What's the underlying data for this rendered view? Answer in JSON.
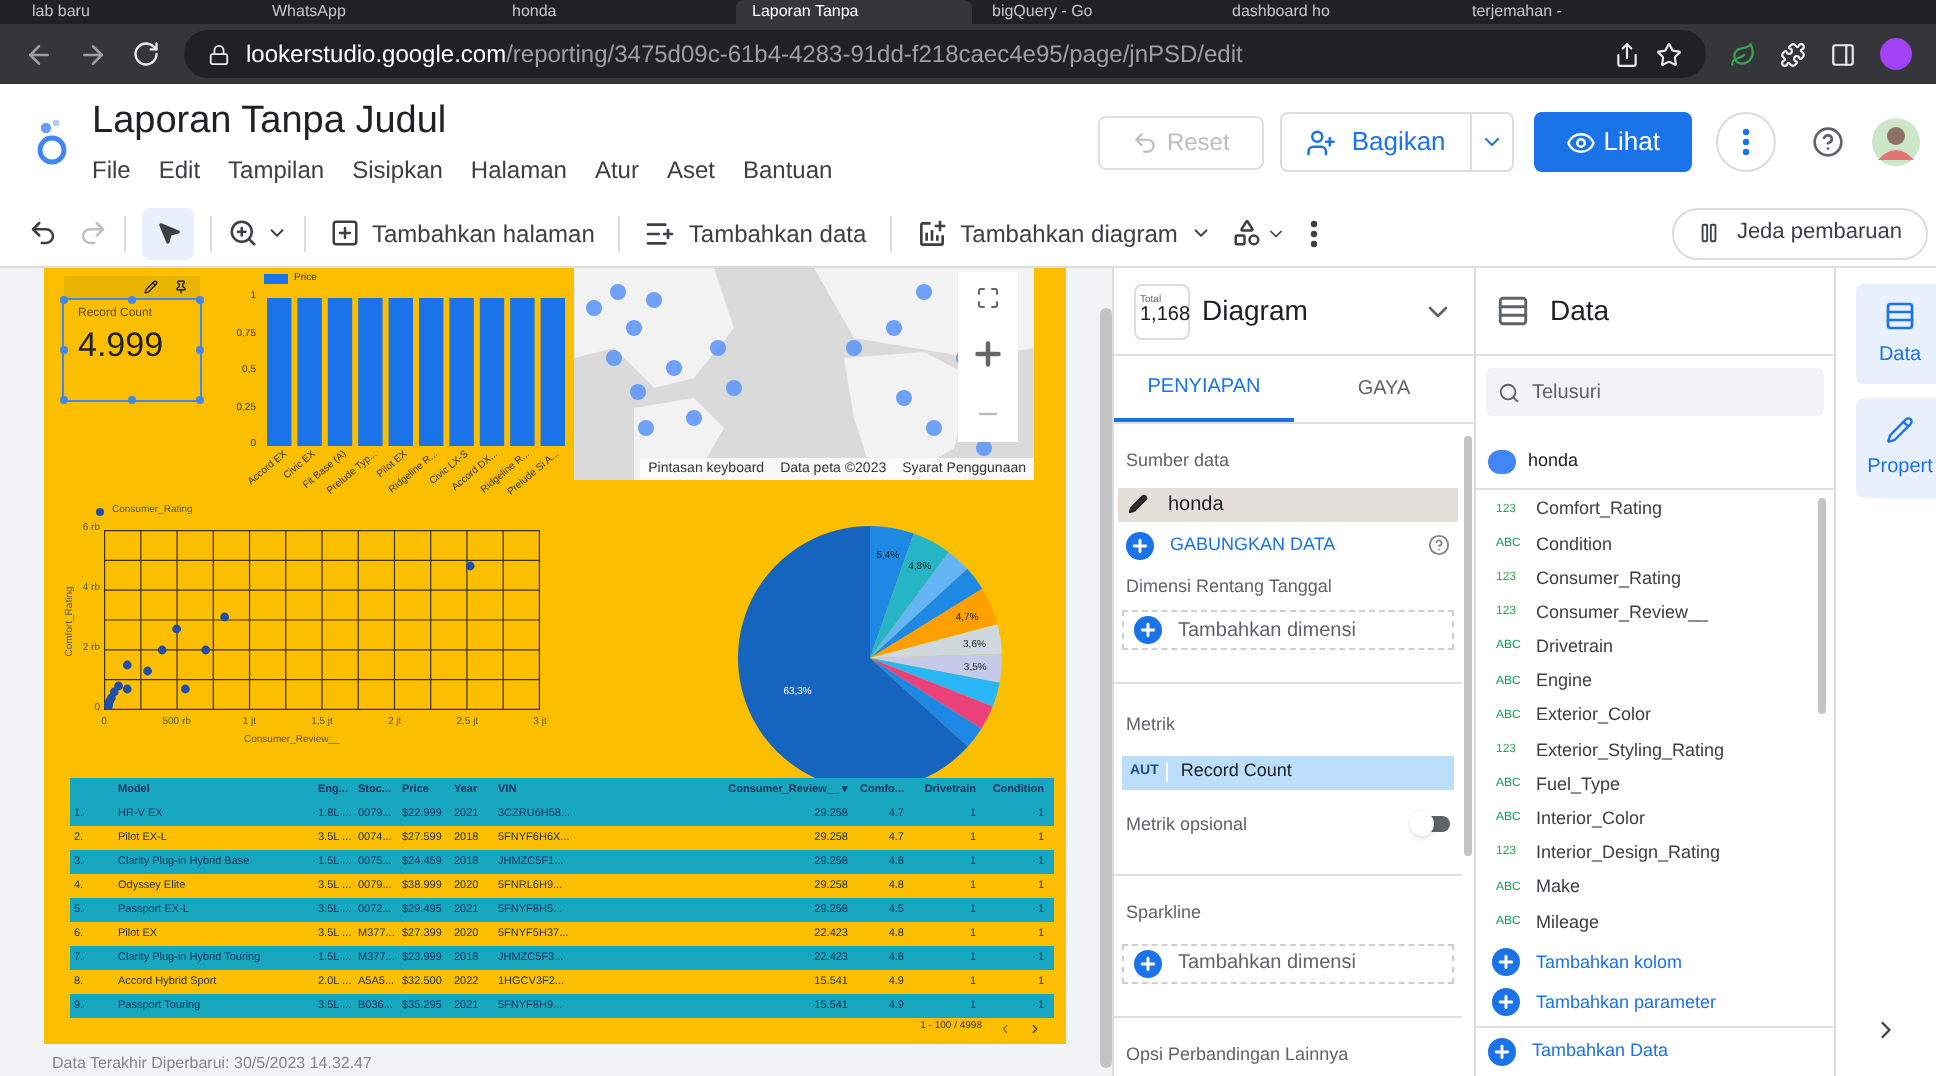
{
  "browser": {
    "tabs": [
      {
        "title": "lab baru",
        "selected": false
      },
      {
        "title": "WhatsApp",
        "selected": false
      },
      {
        "title": "honda",
        "selected": false
      },
      {
        "title": "Laporan Tanpa",
        "selected": true
      },
      {
        "title": "bigQuery - Go",
        "selected": false
      },
      {
        "title": "dashboard ho",
        "selected": false
      },
      {
        "title": "terjemahan -",
        "selected": false
      }
    ],
    "url_host": "lookerstudio.google.com",
    "url_path": "/reporting/3475d09c-61b4-4283-91dd-f218caec4e95/page/jnPSD/edit"
  },
  "app": {
    "title": "Laporan Tanpa Judul",
    "menu": [
      "File",
      "Edit",
      "Tampilan",
      "Sisipkan",
      "Halaman",
      "Atur",
      "Aset",
      "Bantuan"
    ],
    "reset": {
      "label": "Reset",
      "disabled": true
    },
    "share": "Bagikan",
    "view": "Lihat"
  },
  "toolbar": {
    "redo_disabled": true,
    "select_selected": true,
    "add_page": "Tambahkan halaman",
    "add_data": "Tambahkan data",
    "add_chart": "Tambahkan diagram",
    "pause": "Jeda pembaruan"
  },
  "canvas": {
    "scorecard": {
      "label": "Record Count",
      "value": "4.999",
      "selected": true
    },
    "bar_chart": {
      "chart_data": {
        "type": "bar",
        "series": [
          {
            "name": "Price",
            "color": "#1a73e8",
            "values": [
              1,
              1,
              1,
              1,
              1,
              1,
              1,
              1,
              1,
              1
            ]
          }
        ],
        "categories": [
          "Accord EX",
          "Civic EX",
          "Fit Base (A)",
          "Prelude Typ...",
          "Pilot EX",
          "Ridgeline R...",
          "Civic LX-S",
          "Accord DX...",
          "Ridgeline R...",
          "Prelude Si A..."
        ],
        "ylim": [
          0,
          1
        ],
        "yticks": [
          0,
          {
            "value": 0.25,
            "label": "0,25"
          },
          {
            "value": 0.5,
            "label": "0,5"
          },
          {
            "value": 0.75,
            "label": "0,75"
          },
          1
        ]
      }
    },
    "map": {
      "attributions": [
        "Pintasan keyboard",
        "Data peta ©2023",
        "Syarat Penggunaan"
      ]
    },
    "scatter": {
      "legend": "Consumer_Rating",
      "xlabel": "Consumer_Review__",
      "ylabel": "Comfort_Rating",
      "x_tick_labels": [
        "0",
        "500 rb",
        "1 jt",
        "1,5 jt",
        "2 jt",
        "2,5 jt",
        "3 jt"
      ],
      "y_tick_labels": [
        "6 rb",
        "4 rb",
        "2 rb",
        "0"
      ]
    },
    "pie": {
      "chart_data": {
        "type": "pie",
        "series": [
          {
            "values": [
              5.4,
              4.8,
              3.0,
              3.0,
              4.7,
              3.6,
              3.5,
              3.0,
              3.0,
              2.7,
              63.3
            ]
          }
        ],
        "colors": [
          "#1e88e5",
          "#26b5c6",
          "#64b5f6",
          "#1e88e5",
          "#ffa000",
          "#cfd8dc",
          "#c5cae9",
          "#29b6f6",
          "#ec407a",
          "#1e88e5",
          "#1565c0"
        ],
        "value_labels": [
          "5,4%",
          "4,8%",
          null,
          null,
          "4,7%",
          "3,6%",
          "3,5%",
          null,
          null,
          null,
          "63,3%"
        ]
      }
    },
    "table": {
      "columns": [
        "",
        "Model",
        "Eng...",
        "Stoc...",
        "Price",
        "Year",
        "VIN",
        "Consumer_Review__ ▾",
        "Comfo...",
        "Drivetrain",
        "Condition"
      ],
      "rows": [
        {
          "cells": [
            "1.",
            "HR-V EX",
            "1.8L ...",
            "0079...",
            "$22.999",
            "2021",
            "3CZRU6H58...",
            "29.258",
            "4.7",
            "1",
            "1"
          ]
        },
        {
          "cells": [
            "2.",
            "Pilot EX-L",
            "3.5L ...",
            "0074...",
            "$27.599",
            "2018",
            "5FNYF6H6X...",
            "29.258",
            "4.7",
            "1",
            "1"
          ]
        },
        {
          "cells": [
            "3.",
            "Clarity Plug-in Hybrid Base",
            "1.5L ...",
            "0075...",
            "$24.459",
            "2018",
            "JHMZC5F1...",
            "29.258",
            "4.8",
            "1",
            "1"
          ]
        },
        {
          "cells": [
            "4.",
            "Odyssey Elite",
            "3.5L ...",
            "0079...",
            "$38.999",
            "2020",
            "5FNRL6H9...",
            "29.258",
            "4.8",
            "1",
            "1"
          ]
        },
        {
          "cells": [
            "5.",
            "Passport EX-L",
            "3.5L ...",
            "0072...",
            "$29.495",
            "2021",
            "5FNYF8H5...",
            "29.258",
            "4.5",
            "1",
            "1"
          ]
        },
        {
          "cells": [
            "6.",
            "Pilot EX",
            "3.5L ...",
            "M377...",
            "$27.399",
            "2020",
            "5FNYF5H37...",
            "22.423",
            "4.8",
            "1",
            "1"
          ]
        },
        {
          "cells": [
            "7.",
            "Clarity Plug-in Hybrid Touring",
            "1.5L ...",
            "M377...",
            "$23.999",
            "2018",
            "JHMZC5F3...",
            "22.423",
            "4.8",
            "1",
            "1"
          ]
        },
        {
          "cells": [
            "8.",
            "Accord Hybrid Sport",
            "2.0L ...",
            "A5A5...",
            "$32.500",
            "2022",
            "1HGCV3F2...",
            "15.541",
            "4.9",
            "1",
            "1"
          ]
        },
        {
          "cells": [
            "9.",
            "Passport Touring",
            "3.5L ...",
            "B036...",
            "$35.295",
            "2021",
            "5FNYF8H9...",
            "15.541",
            "4.9",
            "1",
            "1"
          ]
        }
      ],
      "pager": "1 - 100 / 4998"
    },
    "updated": "Data Terakhir Diperbarui: 30/5/2023 14.32.47"
  },
  "properties": {
    "total_label": "Total",
    "total_value": "1,168",
    "title": "Diagram",
    "tabs": [
      {
        "label": "PENYIAPAN",
        "selected": true
      },
      {
        "label": "GAYA",
        "selected": false
      }
    ],
    "source_label": "Sumber data",
    "source": "honda",
    "blend": "GABUNGKAN DATA",
    "date_label": "Dimensi Rentang Tanggal",
    "date_placeholder": "Tambahkan dimensi",
    "metric_label": "Metrik",
    "metric_type": "AUT",
    "metric": "Record Count",
    "optional_label": "Metrik opsional",
    "optional_on": false,
    "sparkline_label": "Sparkline",
    "sparkline_placeholder": "Tambahkan dimensi",
    "compare_label": "Opsi Perbandingan Lainnya"
  },
  "data_panel": {
    "title": "Data",
    "search_placeholder": "Telusuri",
    "source": "honda",
    "fields": [
      {
        "type": "123",
        "name": "Comfort_Rating"
      },
      {
        "type": "ABC",
        "name": "Condition"
      },
      {
        "type": "123",
        "name": "Consumer_Rating"
      },
      {
        "type": "123",
        "name": "Consumer_Review__"
      },
      {
        "type": "ABC",
        "name": "Drivetrain"
      },
      {
        "type": "ABC",
        "name": "Engine"
      },
      {
        "type": "ABC",
        "name": "Exterior_Color"
      },
      {
        "type": "123",
        "name": "Exterior_Styling_Rating"
      },
      {
        "type": "ABC",
        "name": "Fuel_Type"
      },
      {
        "type": "ABC",
        "name": "Interior_Color"
      },
      {
        "type": "123",
        "name": "Interior_Design_Rating"
      },
      {
        "type": "ABC",
        "name": "Make"
      },
      {
        "type": "ABC",
        "name": "Mileage"
      }
    ],
    "actions": [
      "Tambahkan kolom",
      "Tambahkan parameter"
    ],
    "add_data": "Tambahkan Data"
  },
  "rail": [
    {
      "label": "Data",
      "kind": "data"
    },
    {
      "label": "Propert",
      "kind": "properties"
    }
  ]
}
